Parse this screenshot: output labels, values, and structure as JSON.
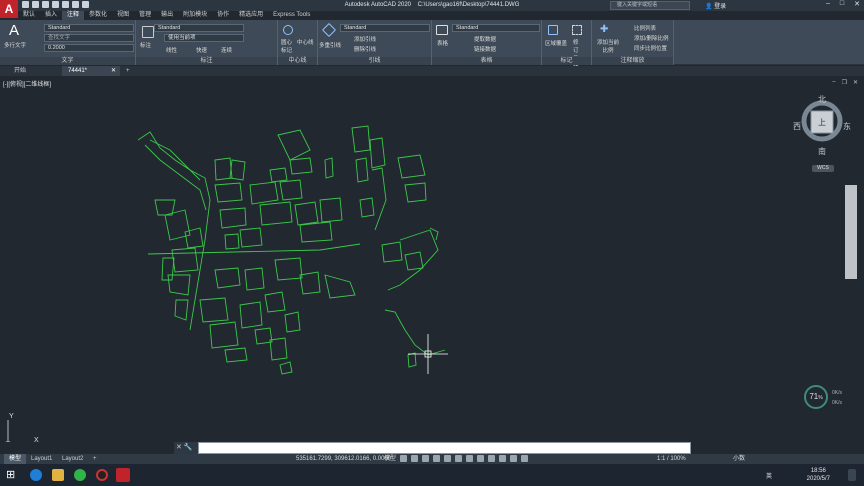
{
  "title": {
    "app": "Autodesk AutoCAD 2020",
    "path": "C:\\Users\\gao16f\\Desktop\\74441.DWG",
    "search_placeholder": "键入关键字或短语",
    "login": "登录",
    "logo": "A"
  },
  "menu_tabs": [
    "默认",
    "插入",
    "注释",
    "参数化",
    "视图",
    "管理",
    "输出",
    "附加模块",
    "协作",
    "精选应用",
    "Express Tools"
  ],
  "ribbon": {
    "text_panel": {
      "big_button": "多行文字",
      "style": "Standard",
      "find": "查找文字",
      "height": "0.2000",
      "title": "文字"
    },
    "dim_panel": {
      "big_button": "标注",
      "style": "Standard",
      "layer": "使用当前项",
      "linear": "线性",
      "quick": "快速",
      "continue": "连续",
      "title": "标注"
    },
    "centerline_panel": {
      "center_mark": "圆心标记",
      "centerline": "中心线",
      "title": "中心线"
    },
    "leader_panel": {
      "big_button": "多重引线",
      "style": "Standard",
      "add": "添加引线",
      "remove": "删除引线",
      "title": "引线"
    },
    "table_panel": {
      "big_button": "表格",
      "style": "Standard",
      "extract": "提取数据",
      "link": "链接数据",
      "title": "表格"
    },
    "markup_panel": {
      "wipeout": "区域覆盖",
      "revcloud": "修订云线",
      "title": "标记"
    },
    "scale_panel": {
      "add_current": "添加当前比例",
      "list": "比例列表",
      "add_delete": "添加/删除比例",
      "sync": "同步比例位置",
      "title": "注释缩放"
    }
  },
  "file_tabs": [
    "开始",
    "74441*"
  ],
  "viewport_label": "[-][俯视][二维线框]",
  "viewcube": {
    "north": "北",
    "south": "南",
    "east": "东",
    "west": "西",
    "top": "上",
    "wcs": "WCS"
  },
  "meter": {
    "value": "71",
    "unit": "%",
    "up": "0K/s",
    "down": "0K/s"
  },
  "ucs": {
    "x": "X",
    "y": "Y"
  },
  "command_line": {
    "value": ""
  },
  "layout_tabs": [
    "模型",
    "Layout1",
    "Layout2"
  ],
  "status": {
    "coords": "535161.7299, 309612.0166, 0.0000",
    "mode": "模型",
    "scale": "1:1 / 100%",
    "units": "小数"
  },
  "taskbar": {
    "ime": "英",
    "time": "18:56",
    "date": "2020/5/7"
  },
  "colors": {
    "background": "#212830",
    "linework": "#3bc84a",
    "ribbon": "#3e4a57"
  }
}
